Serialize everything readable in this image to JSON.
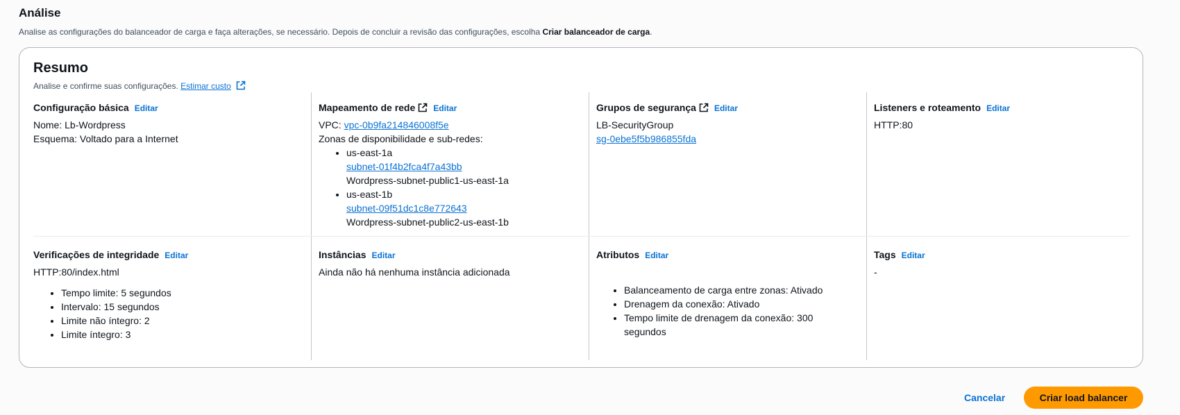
{
  "header": {
    "title": "Análise",
    "description_prefix": "Analise as configurações do balanceador de carga e faça alterações, se necessário. Depois de concluir a revisão das configurações, escolha ",
    "description_bold": "Criar balanceador de carga",
    "description_suffix": "."
  },
  "summary": {
    "title": "Resumo",
    "subtitle": "Analise e confirme suas configurações.",
    "estimate_link": "Estimar custo"
  },
  "edit_label": "Editar",
  "basic": {
    "title": "Configuração básica",
    "name": "Nome: Lb-Wordpress",
    "scheme": "Esquema: Voltado para a Internet"
  },
  "network": {
    "title": "Mapeamento de rede",
    "vpc_label": "VPC:",
    "vpc_link": "vpc-0b9fa214846008f5e",
    "zones_label": "Zonas de disponibilidade e sub-redes:",
    "zones": [
      {
        "zone": "us-east-1a",
        "subnet": "subnet-01f4b2fca4f7a43bb",
        "name": "Wordpress-subnet-public1-us-east-1a"
      },
      {
        "zone": "us-east-1b",
        "subnet": "subnet-09f51dc1c8e772643",
        "name": "Wordpress-subnet-public2-us-east-1b"
      }
    ]
  },
  "security": {
    "title": "Grupos de segurança",
    "group_name": "LB-SecurityGroup",
    "group_link": "sg-0ebe5f5b986855fda"
  },
  "listeners": {
    "title": "Listeners e roteamento",
    "value": "HTTP:80"
  },
  "health": {
    "title": "Verificações de integridade",
    "path": "HTTP:80/index.html",
    "items": [
      "Tempo limite: 5 segundos",
      "Intervalo: 15 segundos",
      "Limite não íntegro: 2",
      "Limite íntegro: 3"
    ]
  },
  "instances": {
    "title": "Instâncias",
    "value": "Ainda não há nenhuma instância adicionada"
  },
  "attributes": {
    "title": "Atributos",
    "items": [
      "Balanceamento de carga entre zonas: Ativado",
      "Drenagem da conexão: Ativado",
      "Tempo limite de drenagem da conexão: 300 segundos"
    ]
  },
  "tags": {
    "title": "Tags",
    "value": "-"
  },
  "footer": {
    "cancel": "Cancelar",
    "create": "Criar load balancer"
  },
  "colors": {
    "link": "#0972d3",
    "primary_button": "#ff9900"
  }
}
